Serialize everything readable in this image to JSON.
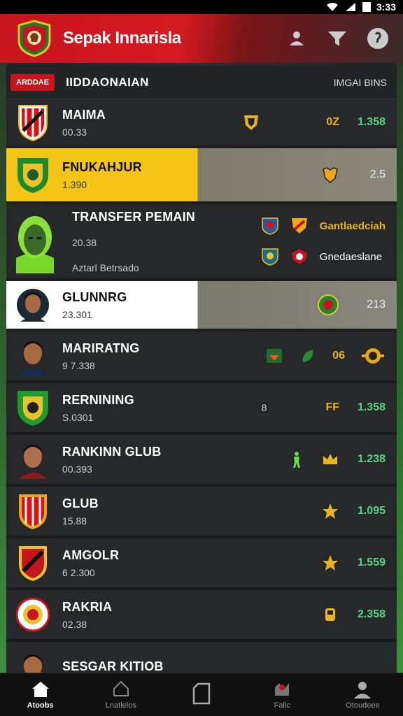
{
  "status_bar": {
    "time": "3:33"
  },
  "header": {
    "title": "Sepak Innarisla"
  },
  "list": {
    "badge": "ARDDAE",
    "title": "IIDDAONAIAN",
    "column_label": "IMGAI BINS"
  },
  "rows": [
    {
      "name": "MAIMA",
      "sub": "00.33",
      "code": "0Z",
      "score": "1.358"
    },
    {
      "name": "FNUKAHJUR",
      "sub": "1.390",
      "score": "2.5"
    },
    {
      "name": "TRANSFER PEMAIN",
      "sub": "20.38",
      "sub2": "Aztarl Betrsado",
      "label1": "Gantlaedciah",
      "label2": "Gnedaeslane"
    },
    {
      "name": "GLUNNRG",
      "sub": "23.301",
      "score": "213"
    },
    {
      "name": "MARIRATNG",
      "sub": "9 7.338",
      "code": "06"
    },
    {
      "name": "RERNINING",
      "sub": "S.0301",
      "extra": "8",
      "code": "FF",
      "score": "1.358"
    },
    {
      "name": "RANKINN GLUB",
      "sub": "00.393",
      "score": "1.238"
    },
    {
      "name": "GLUB",
      "sub": "15.88",
      "score": "1.095"
    },
    {
      "name": "AMGOLR",
      "sub": "6 2.300",
      "score": "1.559"
    },
    {
      "name": "RAKRIA",
      "sub": "02.38",
      "score": "2.358"
    },
    {
      "name": "SESGAR KITIOB",
      "sub": ""
    }
  ],
  "nav": [
    {
      "label": "Atoobs",
      "icon": "home-icon"
    },
    {
      "label": "Lnatlelos",
      "icon": "bell-icon"
    },
    {
      "label": "",
      "icon": "square-icon"
    },
    {
      "label": "Fallc",
      "icon": "stats-icon"
    },
    {
      "label": "Otoudeee",
      "icon": "profile-icon"
    }
  ],
  "colors": {
    "brand_red": "#c8141c",
    "highlight_yellow": "#f2c516",
    "score_green": "#56d48a",
    "code_gold": "#e8b422"
  }
}
